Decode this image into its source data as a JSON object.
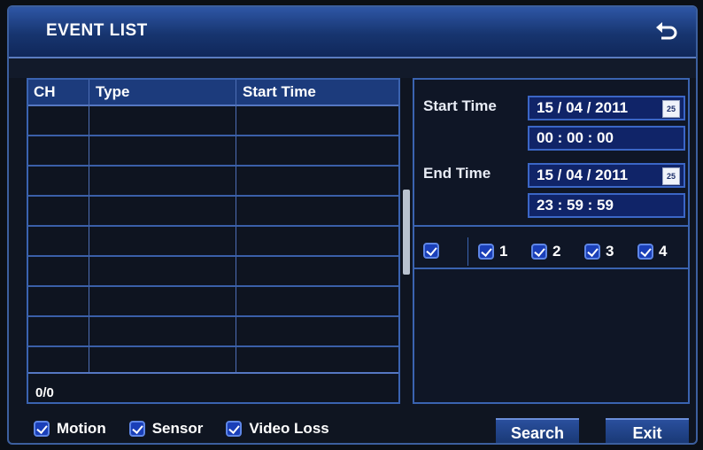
{
  "window": {
    "title": "EVENT LIST",
    "back_icon": "back-arrow-icon"
  },
  "table": {
    "columns": [
      "CH",
      "Type",
      "Start Time"
    ],
    "rows": [],
    "pager": "0/0"
  },
  "filter": {
    "start_label": "Start Time",
    "start_date": "15 / 04 / 2011",
    "start_time": "00  :  00  :  00",
    "end_label": "End Time",
    "end_date": "15 / 04 / 2011",
    "end_time": "23  :  59  :  59",
    "calendar_icon_text": "25",
    "channels": {
      "all": "",
      "items": [
        "1",
        "2",
        "3",
        "4"
      ]
    }
  },
  "event_types": [
    "Motion",
    "Sensor",
    "Video Loss"
  ],
  "buttons": {
    "search": "Search",
    "exit": "Exit"
  },
  "colors": {
    "accent": "#2e56a6",
    "field_bg": "#102468",
    "checkbox": "#1a3fb8"
  }
}
